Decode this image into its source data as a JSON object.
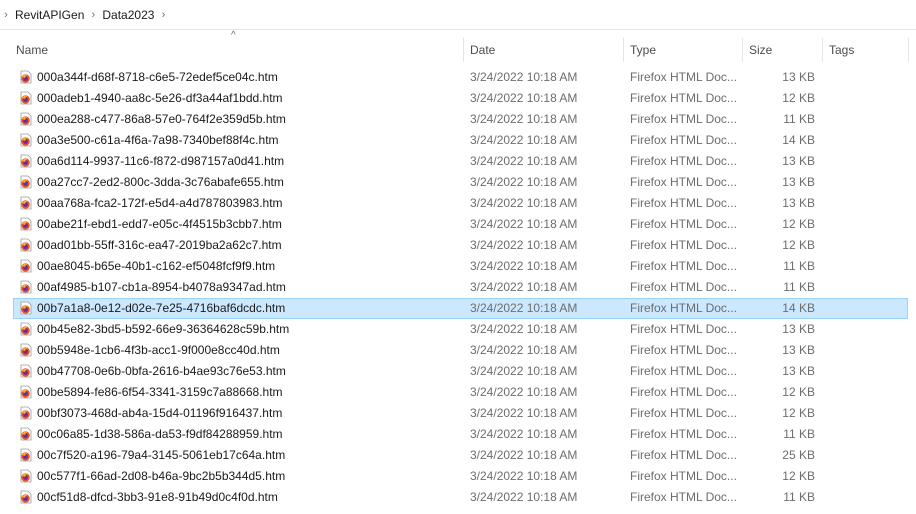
{
  "breadcrumb": {
    "items": [
      "RevitAPIGen",
      "Data2023"
    ],
    "sep": "›"
  },
  "columns": {
    "name": "Name",
    "date": "Date",
    "type": "Type",
    "size": "Size",
    "tags": "Tags",
    "sort_indicator": "^"
  },
  "icons": {
    "file_icon": "firefox-html-file-icon",
    "sort_icon": "sort-ascending-icon"
  },
  "colors": {
    "selection_bg": "#cce8ff",
    "selection_border": "#99d1ff"
  },
  "files": [
    {
      "name": "000a344f-d68f-8718-c6e5-72edef5ce04c.htm",
      "date": "3/24/2022 10:18 AM",
      "type": "Firefox HTML Doc...",
      "size": "13 KB"
    },
    {
      "name": "000adeb1-4940-aa8c-5e26-df3a44af1bdd.htm",
      "date": "3/24/2022 10:18 AM",
      "type": "Firefox HTML Doc...",
      "size": "12 KB"
    },
    {
      "name": "000ea288-c477-86a8-57e0-764f2e359d5b.htm",
      "date": "3/24/2022 10:18 AM",
      "type": "Firefox HTML Doc...",
      "size": "11 KB"
    },
    {
      "name": "00a3e500-c61a-4f6a-7a98-7340bef88f4c.htm",
      "date": "3/24/2022 10:18 AM",
      "type": "Firefox HTML Doc...",
      "size": "14 KB"
    },
    {
      "name": "00a6d114-9937-11c6-f872-d987157a0d41.htm",
      "date": "3/24/2022 10:18 AM",
      "type": "Firefox HTML Doc...",
      "size": "13 KB"
    },
    {
      "name": "00a27cc7-2ed2-800c-3dda-3c76abafe655.htm",
      "date": "3/24/2022 10:18 AM",
      "type": "Firefox HTML Doc...",
      "size": "13 KB"
    },
    {
      "name": "00aa768a-fca2-172f-e5d4-a4d787803983.htm",
      "date": "3/24/2022 10:18 AM",
      "type": "Firefox HTML Doc...",
      "size": "13 KB"
    },
    {
      "name": "00abe21f-ebd1-edd7-e05c-4f4515b3cbb7.htm",
      "date": "3/24/2022 10:18 AM",
      "type": "Firefox HTML Doc...",
      "size": "12 KB"
    },
    {
      "name": "00ad01bb-55ff-316c-ea47-2019ba2a62c7.htm",
      "date": "3/24/2022 10:18 AM",
      "type": "Firefox HTML Doc...",
      "size": "12 KB"
    },
    {
      "name": "00ae8045-b65e-40b1-c162-ef5048fcf9f9.htm",
      "date": "3/24/2022 10:18 AM",
      "type": "Firefox HTML Doc...",
      "size": "11 KB"
    },
    {
      "name": "00af4985-b107-cb1a-8954-b4078a9347ad.htm",
      "date": "3/24/2022 10:18 AM",
      "type": "Firefox HTML Doc...",
      "size": "11 KB"
    },
    {
      "name": "00b7a1a8-0e12-d02e-7e25-4716baf6dcdc.htm",
      "date": "3/24/2022 10:18 AM",
      "type": "Firefox HTML Doc...",
      "size": "14 KB",
      "selected": true
    },
    {
      "name": "00b45e82-3bd5-b592-66e9-36364628c59b.htm",
      "date": "3/24/2022 10:18 AM",
      "type": "Firefox HTML Doc...",
      "size": "13 KB"
    },
    {
      "name": "00b5948e-1cb6-4f3b-acc1-9f000e8cc40d.htm",
      "date": "3/24/2022 10:18 AM",
      "type": "Firefox HTML Doc...",
      "size": "13 KB"
    },
    {
      "name": "00b47708-0e6b-0bfa-2616-b4ae93c76e53.htm",
      "date": "3/24/2022 10:18 AM",
      "type": "Firefox HTML Doc...",
      "size": "13 KB"
    },
    {
      "name": "00be5894-fe86-6f54-3341-3159c7a88668.htm",
      "date": "3/24/2022 10:18 AM",
      "type": "Firefox HTML Doc...",
      "size": "12 KB"
    },
    {
      "name": "00bf3073-468d-ab4a-15d4-01196f916437.htm",
      "date": "3/24/2022 10:18 AM",
      "type": "Firefox HTML Doc...",
      "size": "12 KB"
    },
    {
      "name": "00c06a85-1d38-586a-da53-f9df84288959.htm",
      "date": "3/24/2022 10:18 AM",
      "type": "Firefox HTML Doc...",
      "size": "11 KB"
    },
    {
      "name": "00c7f520-a196-79a4-3145-5061eb17c64a.htm",
      "date": "3/24/2022 10:18 AM",
      "type": "Firefox HTML Doc...",
      "size": "25 KB"
    },
    {
      "name": "00c577f1-66ad-2d08-b46a-9bc2b5b344d5.htm",
      "date": "3/24/2022 10:18 AM",
      "type": "Firefox HTML Doc...",
      "size": "12 KB"
    },
    {
      "name": "00cf51d8-dfcd-3bb3-91e8-91b49d0c4f0d.htm",
      "date": "3/24/2022 10:18 AM",
      "type": "Firefox HTML Doc...",
      "size": "11 KB"
    }
  ]
}
